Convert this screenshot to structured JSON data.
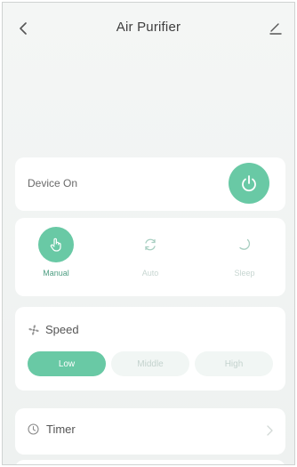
{
  "header": {
    "title": "Air Purifier",
    "back_icon": "chevron-left-icon",
    "edit_icon": "pencil-icon"
  },
  "power": {
    "label": "Device On",
    "icon": "power-icon",
    "state": "on"
  },
  "modes": {
    "selected": "Manual",
    "items": [
      {
        "label": "Manual",
        "icon": "hand-pointer-icon",
        "active": true
      },
      {
        "label": "Auto",
        "icon": "auto-cycle-icon",
        "active": false
      },
      {
        "label": "Sleep",
        "icon": "moon-icon",
        "active": false
      }
    ]
  },
  "speed": {
    "title": "Speed",
    "icon": "fan-icon",
    "options": [
      {
        "label": "Low",
        "active": true
      },
      {
        "label": "Middle",
        "active": false
      },
      {
        "label": "High",
        "active": false
      }
    ]
  },
  "timer": {
    "title": "Timer",
    "icon": "clock-icon",
    "chevron_icon": "chevron-right-icon"
  },
  "colors": {
    "accent": "#69c9a5",
    "background": "#eef1f0",
    "card": "#ffffff"
  }
}
